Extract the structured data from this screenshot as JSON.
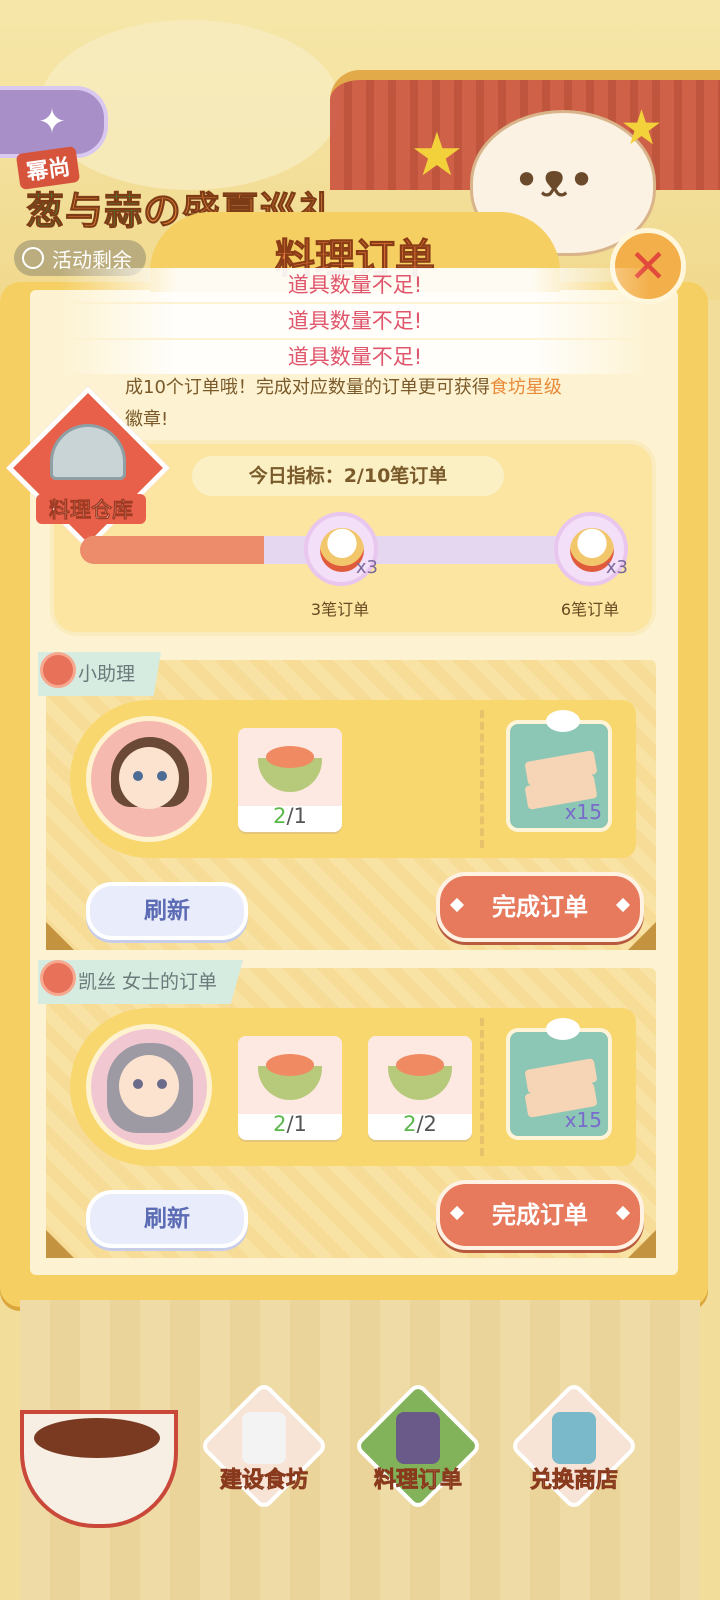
{
  "event": {
    "badge": "幂尚",
    "title_part1": "葱",
    "title_part2": "与",
    "title_part3": "蒜",
    "title_part4": "の盛夏巡礼",
    "remaining_label": "活动剩余"
  },
  "dialog": {
    "title": "料理订单",
    "toasts": [
      "道具数量不足!",
      "道具数量不足!",
      "道具数量不足!"
    ],
    "desc_line1": "成10个订单哦！完成对应数量的订单更可获得",
    "desc_highlight": "食坊星级",
    "desc_line2": "徽章!"
  },
  "progress": {
    "warehouse_label": "料理仓库",
    "target_text": "今日指标：2/10笔订单",
    "fill_ratio": 0.34,
    "milestones": [
      {
        "label": "3笔订单",
        "qty": "x3"
      },
      {
        "label": "6笔订单",
        "qty": "x3"
      }
    ]
  },
  "orders": [
    {
      "title": "小助理",
      "items": [
        {
          "have": "2",
          "need": "/1"
        }
      ],
      "reward_qty": "x15",
      "refresh_label": "刷新",
      "complete_label": "完成订单"
    },
    {
      "title": "凯丝 女士的订单",
      "items": [
        {
          "have": "2",
          "need": "/1"
        },
        {
          "have": "2",
          "need": "/2"
        }
      ],
      "reward_qty": "x15",
      "refresh_label": "刷新",
      "complete_label": "完成订单"
    }
  ],
  "nav": [
    {
      "label": "建设食坊",
      "icon": "chef-hat-icon",
      "color": "#f3f3f3"
    },
    {
      "label": "料理订单",
      "icon": "clipboard-icon",
      "color": "#6a5a8a"
    },
    {
      "label": "兑换商店",
      "icon": "shop-icon",
      "color": "#7ab9c9"
    }
  ],
  "colors": {
    "accent_orange": "#e77a5d",
    "panel_yellow": "#f6cf63",
    "have_green": "#5cb84b",
    "refresh_blue": "#5b6bb4"
  }
}
